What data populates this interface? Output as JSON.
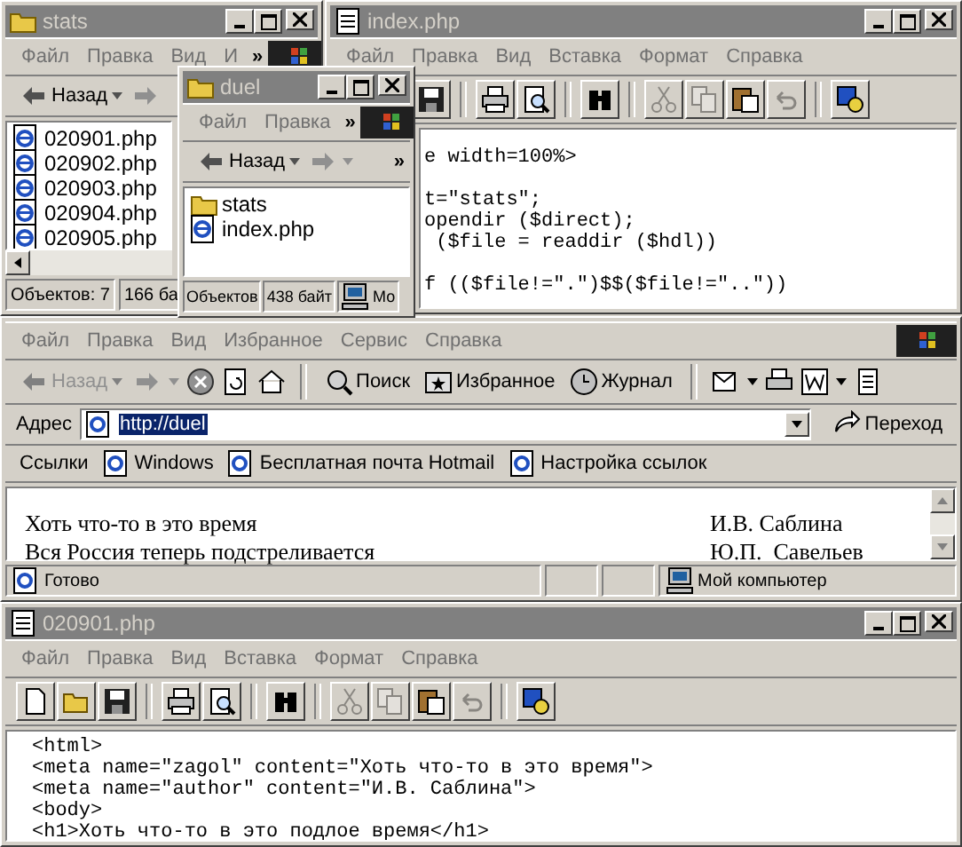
{
  "explorers": [
    {
      "title": "stats",
      "active": false,
      "menu": [
        "Файл",
        "Правка",
        "Вид",
        "И"
      ],
      "more": "»",
      "back": "Назад",
      "items": [
        {
          "kind": "php",
          "name": "020901.php"
        },
        {
          "kind": "php",
          "name": "020902.php"
        },
        {
          "kind": "php",
          "name": "020903.php"
        },
        {
          "kind": "php",
          "name": "020904.php"
        },
        {
          "kind": "php",
          "name": "020905.php"
        }
      ],
      "status": [
        {
          "kind": "plain",
          "text": "Объектов: 7"
        },
        {
          "kind": "plain",
          "text": "166 ба"
        }
      ]
    },
    {
      "title": "duel",
      "active": false,
      "menu": [
        "Файл",
        "Правка"
      ],
      "more": "»",
      "back": "Назад",
      "toolbar_more": "»",
      "items": [
        {
          "kind": "folder",
          "name": "stats"
        },
        {
          "kind": "php",
          "name": "index.php"
        }
      ],
      "status": [
        {
          "kind": "plain",
          "text": "Объектов"
        },
        {
          "kind": "plain",
          "text": "438 байт"
        },
        {
          "kind": "computer",
          "text": "Мо"
        }
      ]
    }
  ],
  "editors": [
    {
      "title": "index.php",
      "active": false,
      "menu": [
        "Файл",
        "Правка",
        "Вид",
        "Вставка",
        "Формат",
        "Справка"
      ],
      "toolbar": [
        {
          "kind": "save",
          "disabled": false
        },
        {
          "kind": "print",
          "disabled": false
        },
        {
          "kind": "preview",
          "disabled": false
        },
        {
          "kind": "find",
          "disabled": false
        },
        {
          "kind": "cut",
          "disabled": true
        },
        {
          "kind": "copy",
          "disabled": true
        },
        {
          "kind": "paste",
          "disabled": false
        },
        {
          "kind": "undo",
          "disabled": true
        },
        {
          "kind": "special",
          "disabled": false
        }
      ],
      "code": [
        [
          "e width=100%>"
        ],
        [
          "t=\"stats\";",
          "opendir ($direct);",
          " ($file = readdir ($hdl))"
        ],
        [
          "f (($file!=\".\")$$($file!=\"..\"))"
        ]
      ]
    },
    {
      "title": "020901.php",
      "active": false,
      "menu": [
        "Файл",
        "Правка",
        "Вид",
        "Вставка",
        "Формат",
        "Справка"
      ],
      "toolbar": [
        {
          "kind": "new",
          "disabled": false
        },
        {
          "kind": "open",
          "disabled": false
        },
        {
          "kind": "save",
          "disabled": false
        },
        {
          "kind": "print",
          "disabled": false
        },
        {
          "kind": "preview",
          "disabled": false
        },
        {
          "kind": "find",
          "disabled": false
        },
        {
          "kind": "cut",
          "disabled": true
        },
        {
          "kind": "copy",
          "disabled": true
        },
        {
          "kind": "paste",
          "disabled": false
        },
        {
          "kind": "undo",
          "disabled": true
        },
        {
          "kind": "special",
          "disabled": false
        }
      ],
      "code": [
        [
          "<html>",
          "<meta name=\"zagol\" content=\"Хоть что-то в это время\">",
          "<meta name=\"author\" content=\"И.В. Саблина\">",
          "<body>",
          "<h1>Хоть что-то в это подлое время</h1>"
        ]
      ]
    }
  ],
  "browser": {
    "menu": [
      "Файл",
      "Правка",
      "Вид",
      "Избранное",
      "Сервис",
      "Справка"
    ],
    "back": "Назад",
    "back_disabled": true,
    "search": "Поиск",
    "favorites": "Избранное",
    "history": "Журнал",
    "address_label": "Адрес",
    "address": "http://duel",
    "address_selected": true,
    "go": "Переход",
    "links_label": "Ссылки",
    "links": [
      "Windows",
      "Бесплатная почта Hotmail",
      "Настройка ссылок"
    ],
    "content": [
      {
        "text": "Хоть что-то в это время",
        "author": "И.В. Саблина"
      },
      {
        "text": "Вся Россия теперь подстреливается",
        "author": "Ю.П.  Савельев"
      }
    ],
    "status": "Готово",
    "zone": "Мой компьютер"
  }
}
